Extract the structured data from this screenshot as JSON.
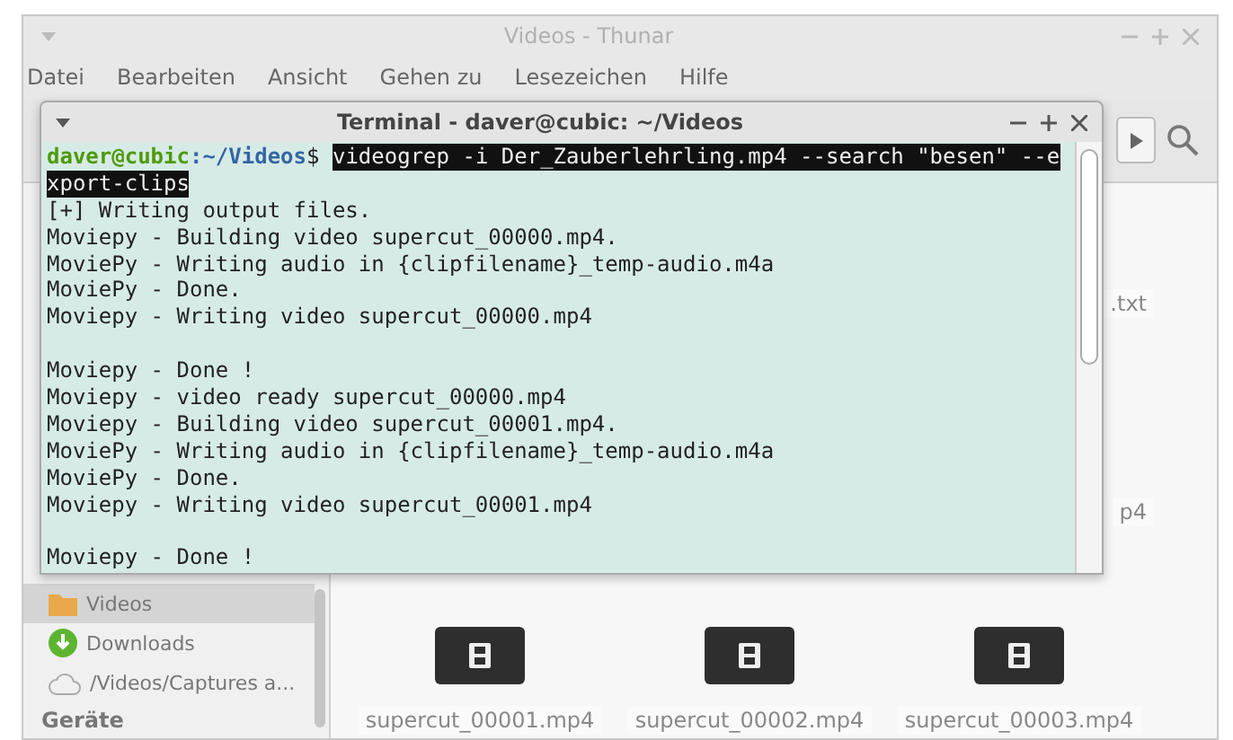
{
  "thunar": {
    "title": "Videos - Thunar",
    "active": false,
    "menu": [
      "Datei",
      "Bearbeiten",
      "Ansicht",
      "Gehen zu",
      "Lesezeichen",
      "Hilfe"
    ],
    "sidebar": {
      "items": [
        {
          "kind": "folder",
          "label": "Videos",
          "selected": true
        },
        {
          "kind": "download",
          "label": "Downloads",
          "selected": false
        },
        {
          "kind": "cloud",
          "label": "/Videos/Captures a...",
          "selected": false
        }
      ],
      "section": "Geräte"
    },
    "files": [
      {
        "kind": "covered",
        "name": ".txt"
      },
      {
        "kind": "covered",
        "name": "p4"
      },
      {
        "kind": "video",
        "name": "supercut_00001.mp4"
      },
      {
        "kind": "video",
        "name": "supercut_00002.mp4"
      },
      {
        "kind": "video",
        "name": "supercut_00003.mp4"
      }
    ]
  },
  "terminal": {
    "title": "Terminal - daver@cubic: ~/Videos",
    "active": true,
    "prompt": {
      "user": "daver@cubic",
      "path": ":~/Videos",
      "symbol": "$"
    },
    "command_lines": [
      "videogrep -i Der_Zauberlehrling.mp4 --search \"besen\" --e",
      "xport-clips"
    ],
    "output_blocks": [
      [
        "[+] Writing output files.",
        "Moviepy - Building video supercut_00000.mp4.",
        "MoviePy - Writing audio in {clipfilename}_temp-audio.m4a",
        "MoviePy - Done.",
        "Moviepy - Writing video supercut_00000.mp4"
      ],
      [
        "Moviepy - Done !",
        "Moviepy - video ready supercut_00000.mp4",
        "Moviepy - Building video supercut_00001.mp4.",
        "MoviePy - Writing audio in {clipfilename}_temp-audio.m4a",
        "MoviePy - Done.",
        "Moviepy - Writing video supercut_00001.mp4"
      ],
      [
        "Moviepy - Done !"
      ]
    ]
  }
}
